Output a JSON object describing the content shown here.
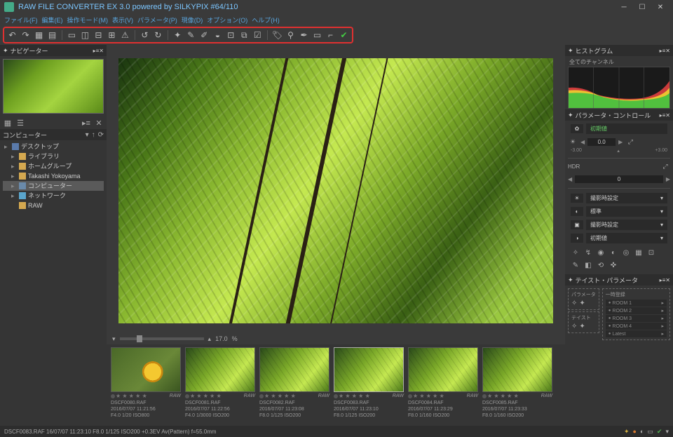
{
  "title": "RAW FILE CONVERTER EX 3.0 powered by SILKYPIX   #64/110",
  "menu": [
    "ファイル(F)",
    "編集(E)",
    "操作モード(M)",
    "表示(V)",
    "パラメータ(P)",
    "現像(D)",
    "オプション(O)",
    "ヘルプ(H)"
  ],
  "panels": {
    "navigator": "ナビゲーター",
    "computer": "コンピューター",
    "histogram": "ヒストグラム",
    "histogram_sub": "全てのチャンネル",
    "param_control": "パラメータ・コントロール",
    "taste_param": "テイスト・パラメータ"
  },
  "tree": [
    {
      "label": "デスクトップ",
      "icon": "desktop",
      "exp": "▸"
    },
    {
      "label": "ライブラリ",
      "icon": "folder",
      "indent": 1,
      "exp": "▸"
    },
    {
      "label": "ホームグループ",
      "icon": "folder",
      "indent": 1,
      "exp": "▸"
    },
    {
      "label": "Takashi Yokoyama",
      "icon": "folder",
      "indent": 1,
      "exp": "▸"
    },
    {
      "label": "コンピューター",
      "icon": "computer",
      "indent": 1,
      "exp": "▸",
      "sel": true
    },
    {
      "label": "ネットワーク",
      "icon": "network",
      "indent": 1,
      "exp": "▸"
    },
    {
      "label": "RAW",
      "icon": "folder",
      "indent": 1,
      "exp": ""
    }
  ],
  "zoom": {
    "value": "17.0",
    "pct": "%"
  },
  "thumbs": [
    {
      "name": "DSCF0080.RAF",
      "date": "2016/07/07 11:21:56",
      "exp": "F4.0 1/20 ISO800",
      "flower": true
    },
    {
      "name": "DSCF0081.RAF",
      "date": "2016/07/07 11:22:56",
      "exp": "F4.0 1/3000 ISO200"
    },
    {
      "name": "DSCF0082.RAF",
      "date": "2016/07/07 11:23:08",
      "exp": "F8.0 1/125 ISO200"
    },
    {
      "name": "DSCF0083.RAF",
      "date": "2016/07/07 11:23:10",
      "exp": "F8.0 1/125 ISO200",
      "sel": true
    },
    {
      "name": "DSCF0084.RAF",
      "date": "2016/07/07 11:23:29",
      "exp": "F8.0 1/160 ISO200"
    },
    {
      "name": "DSCF0085.RAF",
      "date": "2016/07/07 11:23:33",
      "exp": "F8.0 1/160 ISO200"
    }
  ],
  "raw_badge": "RAW",
  "param": {
    "default_label": "初期値",
    "ev_val": "0.0",
    "ev_min": "-3.00",
    "ev_max": "+3.00",
    "hdr_label": "HDR",
    "hdr_val": "0",
    "btn1": "撮影時設定",
    "btn2": "標準",
    "btn3": "撮影時設定",
    "btn4": "初期値"
  },
  "taste": {
    "param_label": "パラメータ",
    "taste_label": "テイスト",
    "temp_label": "一時登録",
    "rooms": [
      "ROOM 1",
      "ROOM 2",
      "ROOM 3",
      "ROOM 4",
      "Latest"
    ]
  },
  "status": "DSCF0083.RAF 16/07/07 11:23:10 F8.0 1/125 ISO200 +0.3EV Av(Pattern) f=55.0mm"
}
